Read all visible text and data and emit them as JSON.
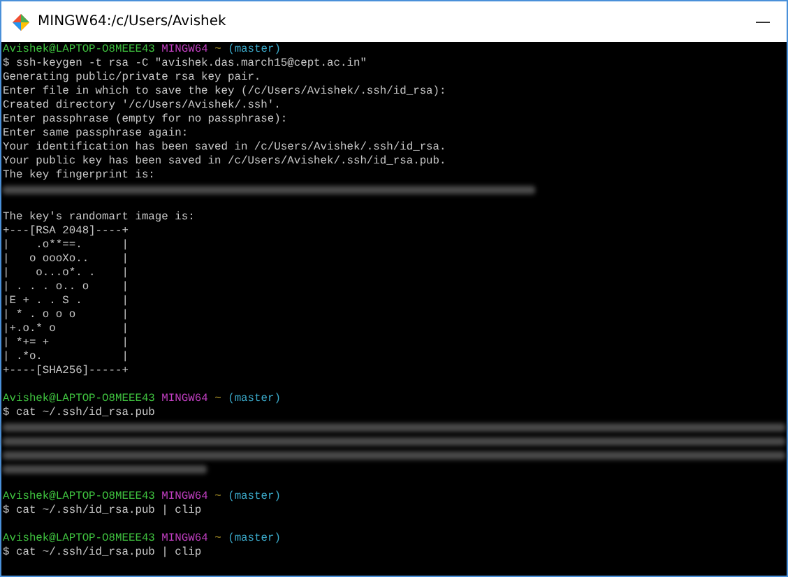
{
  "window": {
    "title": "MINGW64:/c/Users/Avishek"
  },
  "terminal": {
    "lines": [
      {
        "kind": "prompt",
        "user": "Avishek@LAPTOP-O8MEEE43",
        "system": "MINGW64",
        "path": "~",
        "branch": "(master)"
      },
      {
        "kind": "command",
        "text": "$ ssh-keygen -t rsa -C \"avishek.das.march15@cept.ac.in\""
      },
      {
        "kind": "output",
        "text": "Generating public/private rsa key pair."
      },
      {
        "kind": "output",
        "text": "Enter file in which to save the key (/c/Users/Avishek/.ssh/id_rsa):"
      },
      {
        "kind": "output",
        "text": "Created directory '/c/Users/Avishek/.ssh'."
      },
      {
        "kind": "output",
        "text": "Enter passphrase (empty for no passphrase):"
      },
      {
        "kind": "output",
        "text": "Enter same passphrase again:"
      },
      {
        "kind": "output",
        "text": "Your identification has been saved in /c/Users/Avishek/.ssh/id_rsa."
      },
      {
        "kind": "output",
        "text": "Your public key has been saved in /c/Users/Avishek/.ssh/id_rsa.pub."
      },
      {
        "kind": "output",
        "text": "The key fingerprint is:"
      },
      {
        "kind": "redacted"
      },
      {
        "kind": "blank"
      },
      {
        "kind": "output",
        "text": "The key's randomart image is:"
      },
      {
        "kind": "output",
        "text": "+---[RSA 2048]----+"
      },
      {
        "kind": "output",
        "text": "|    .o**==.      |"
      },
      {
        "kind": "output",
        "text": "|   o oooXo..     |"
      },
      {
        "kind": "output",
        "text": "|    o...o*. .    |"
      },
      {
        "kind": "output",
        "text": "| . . . o.. o     |"
      },
      {
        "kind": "output",
        "text": "|E + . . S .      |"
      },
      {
        "kind": "output",
        "text": "| * . o o o       |"
      },
      {
        "kind": "output",
        "text": "|+.o.* o          |"
      },
      {
        "kind": "output",
        "text": "| *+= +           |"
      },
      {
        "kind": "output",
        "text": "| .*o.            |"
      },
      {
        "kind": "output",
        "text": "+----[SHA256]-----+"
      },
      {
        "kind": "blank"
      },
      {
        "kind": "prompt",
        "user": "Avishek@LAPTOP-O8MEEE43",
        "system": "MINGW64",
        "path": "~",
        "branch": "(master)"
      },
      {
        "kind": "command",
        "text": "$ cat ~/.ssh/id_rsa.pub"
      },
      {
        "kind": "redacted"
      },
      {
        "kind": "redacted"
      },
      {
        "kind": "redacted"
      },
      {
        "kind": "redacted"
      },
      {
        "kind": "blank"
      },
      {
        "kind": "prompt",
        "user": "Avishek@LAPTOP-O8MEEE43",
        "system": "MINGW64",
        "path": "~",
        "branch": "(master)"
      },
      {
        "kind": "command",
        "text": "$ cat ~/.ssh/id_rsa.pub | clip"
      },
      {
        "kind": "blank"
      },
      {
        "kind": "prompt",
        "user": "Avishek@LAPTOP-O8MEEE43",
        "system": "MINGW64",
        "path": "~",
        "branch": "(master)"
      },
      {
        "kind": "command",
        "text": "$ cat ~/.ssh/id_rsa.pub | clip"
      }
    ]
  }
}
